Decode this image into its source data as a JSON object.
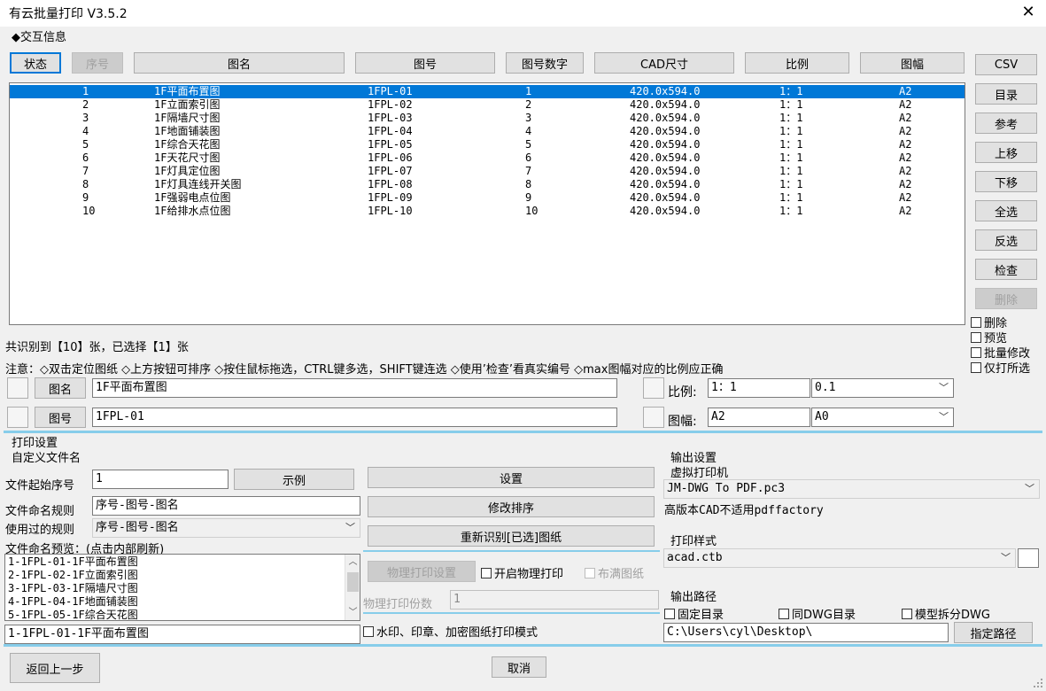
{
  "window": {
    "title": "有云批量打印 V3.5.2"
  },
  "interaction_group": {
    "label": "◆交互信息"
  },
  "columns": {
    "status": "状态",
    "seq": "序号",
    "name": "图名",
    "number": "图号",
    "number_digit": "图号数字",
    "cad_size": "CAD尺寸",
    "scale": "比例",
    "sheet": "图幅"
  },
  "rows": [
    {
      "seq": "1",
      "name": "1F平面布置图",
      "number": "1FPL-01",
      "digit": "1",
      "size": "420.0x594.0",
      "scale": "1：1",
      "sheet": "A2"
    },
    {
      "seq": "2",
      "name": "1F立面索引图",
      "number": "1FPL-02",
      "digit": "2",
      "size": "420.0x594.0",
      "scale": "1：1",
      "sheet": "A2"
    },
    {
      "seq": "3",
      "name": "1F隔墙尺寸图",
      "number": "1FPL-03",
      "digit": "3",
      "size": "420.0x594.0",
      "scale": "1：1",
      "sheet": "A2"
    },
    {
      "seq": "4",
      "name": "1F地面铺装图",
      "number": "1FPL-04",
      "digit": "4",
      "size": "420.0x594.0",
      "scale": "1：1",
      "sheet": "A2"
    },
    {
      "seq": "5",
      "name": "1F综合天花图",
      "number": "1FPL-05",
      "digit": "5",
      "size": "420.0x594.0",
      "scale": "1：1",
      "sheet": "A2"
    },
    {
      "seq": "6",
      "name": "1F天花尺寸图",
      "number": "1FPL-06",
      "digit": "6",
      "size": "420.0x594.0",
      "scale": "1：1",
      "sheet": "A2"
    },
    {
      "seq": "7",
      "name": "1F灯具定位图",
      "number": "1FPL-07",
      "digit": "7",
      "size": "420.0x594.0",
      "scale": "1：1",
      "sheet": "A2"
    },
    {
      "seq": "8",
      "name": "1F灯具连线开关图",
      "number": "1FPL-08",
      "digit": "8",
      "size": "420.0x594.0",
      "scale": "1：1",
      "sheet": "A2"
    },
    {
      "seq": "9",
      "name": "1F强弱电点位图",
      "number": "1FPL-09",
      "digit": "9",
      "size": "420.0x594.0",
      "scale": "1：1",
      "sheet": "A2"
    },
    {
      "seq": "10",
      "name": "1F给排水点位图",
      "number": "1FPL-10",
      "digit": "10",
      "size": "420.0x594.0",
      "scale": "1：1",
      "sheet": "A2"
    }
  ],
  "side_buttons": {
    "csv": "CSV",
    "catalog": "目录",
    "reference": "参考",
    "move_up": "上移",
    "move_down": "下移",
    "select_all": "全选",
    "invert": "反选",
    "check": "检查",
    "delete": "删除"
  },
  "side_checkboxes": {
    "delete": "删除",
    "preview": "预览",
    "batch_edit": "批量修改",
    "print_selected": "仅打所选"
  },
  "status_text": "共识别到【10】张，已选择【1】张",
  "note_text": "注意：◇双击定位图纸 ◇上方按钮可排序 ◇按住鼠标拖选，CTRL键多选，SHIFT键连选 ◇使用’检查’看真实编号 ◇max图幅对应的比例应正确",
  "edit": {
    "name_button": "图名",
    "name_value": "1F平面布置图",
    "number_button": "图号",
    "number_value": "1FPL-01",
    "scale_label": "比例:",
    "scale_value": "1：1",
    "scale_combo": "0.1",
    "sheet_label": "图幅:",
    "sheet_value": "A2",
    "sheet_combo": "A0"
  },
  "print_settings": {
    "label": "打印设置",
    "custom_filename_label": "自定义文件名",
    "start_seq_label": "文件起始序号",
    "start_seq_value": "1",
    "example_button": "示例",
    "naming_rule_label": "文件命名规则",
    "naming_rule_value": "序号-图号-图名",
    "used_rule_label": "使用过的规则",
    "used_rule_value": "序号-图号-图名",
    "preview_label": "文件命名预览：(点击内部刷新)",
    "preview_items": [
      "1-1FPL-01-1F平面布置图",
      "2-1FPL-02-1F立面索引图",
      "3-1FPL-03-1F隔墙尺寸图",
      "4-1FPL-04-1F地面铺装图",
      "5-1FPL-05-1F综合天花图"
    ],
    "preview_selected": "1-1FPL-01-1F平面布置图",
    "settings_button": "设置",
    "reorder_button": "修改排序",
    "re_identify_button": "重新识别[已选]图纸",
    "physical_settings_button": "物理打印设置",
    "enable_physical_label": "开启物理打印",
    "fill_paper_label": "布满图纸",
    "copies_label": "物理打印份数",
    "copies_value": "1",
    "watermark_label": "水印、印章、加密图纸打印模式"
  },
  "output_settings": {
    "label": "输出设置",
    "virtual_printer_label": "虚拟打印机",
    "printer_value": "JM-DWG To PDF.pc3",
    "printer_note": "高版本CAD不适用pdffactory",
    "plot_style_label": "打印样式",
    "plot_style_value": "acad.ctb",
    "output_path_label": "输出路径",
    "fixed_dir_label": "固定目录",
    "same_dwg_dir_label": "同DWG目录",
    "model_split_label": "模型拆分DWG",
    "path_value": "C:\\Users\\cyl\\Desktop\\",
    "choose_path_button": "指定路径"
  },
  "footer": {
    "back_button": "返回上一步",
    "cancel_button": "取消"
  },
  "icons": {
    "close": "close-icon",
    "dropdown": "chevron-down-icon"
  },
  "colors": {
    "selection": "#0078d7",
    "separator": "#87cdea"
  }
}
